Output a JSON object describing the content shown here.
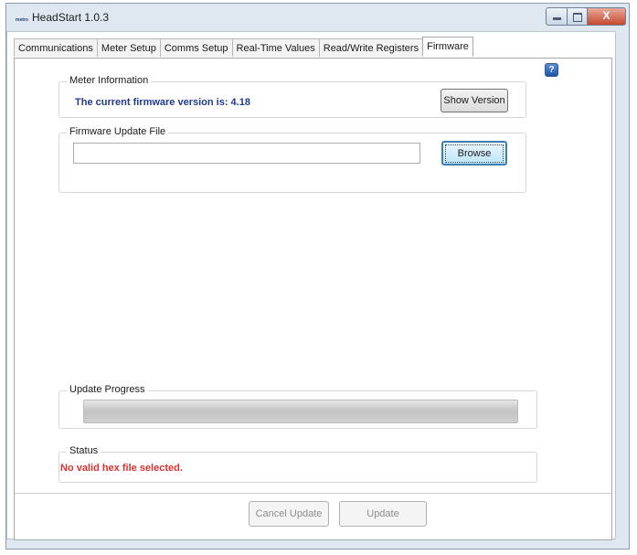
{
  "window": {
    "app_icon_text": "metro",
    "title": "HeadStart 1.0.3",
    "minimize_icon": "minimize-icon",
    "maximize_icon": "maximize-icon",
    "close_glyph": "X"
  },
  "tabs": [
    {
      "label": "Communications",
      "active": false
    },
    {
      "label": "Meter Setup",
      "active": false
    },
    {
      "label": "Comms Setup",
      "active": false
    },
    {
      "label": "Real-Time Values",
      "active": false
    },
    {
      "label": "Read/Write Registers",
      "active": false
    },
    {
      "label": "Firmware",
      "active": true
    }
  ],
  "help": {
    "glyph": "?"
  },
  "meter_info": {
    "legend": "Meter Information",
    "version_text": "The current firmware version is: 4.18",
    "show_version_label": "Show Version"
  },
  "firmware_file": {
    "legend": "Firmware Update File",
    "path_value": "",
    "browse_label": "Browse"
  },
  "update_progress": {
    "legend": "Update Progress",
    "progress": 0
  },
  "status": {
    "legend": "Status",
    "message": "No valid hex file selected.",
    "message_color": "#e03131"
  },
  "footer": {
    "cancel_label": "Cancel Update",
    "update_label": "Update"
  },
  "colors": {
    "version_text": "#1f3a8f",
    "accent_button": "#3c7fb1"
  }
}
